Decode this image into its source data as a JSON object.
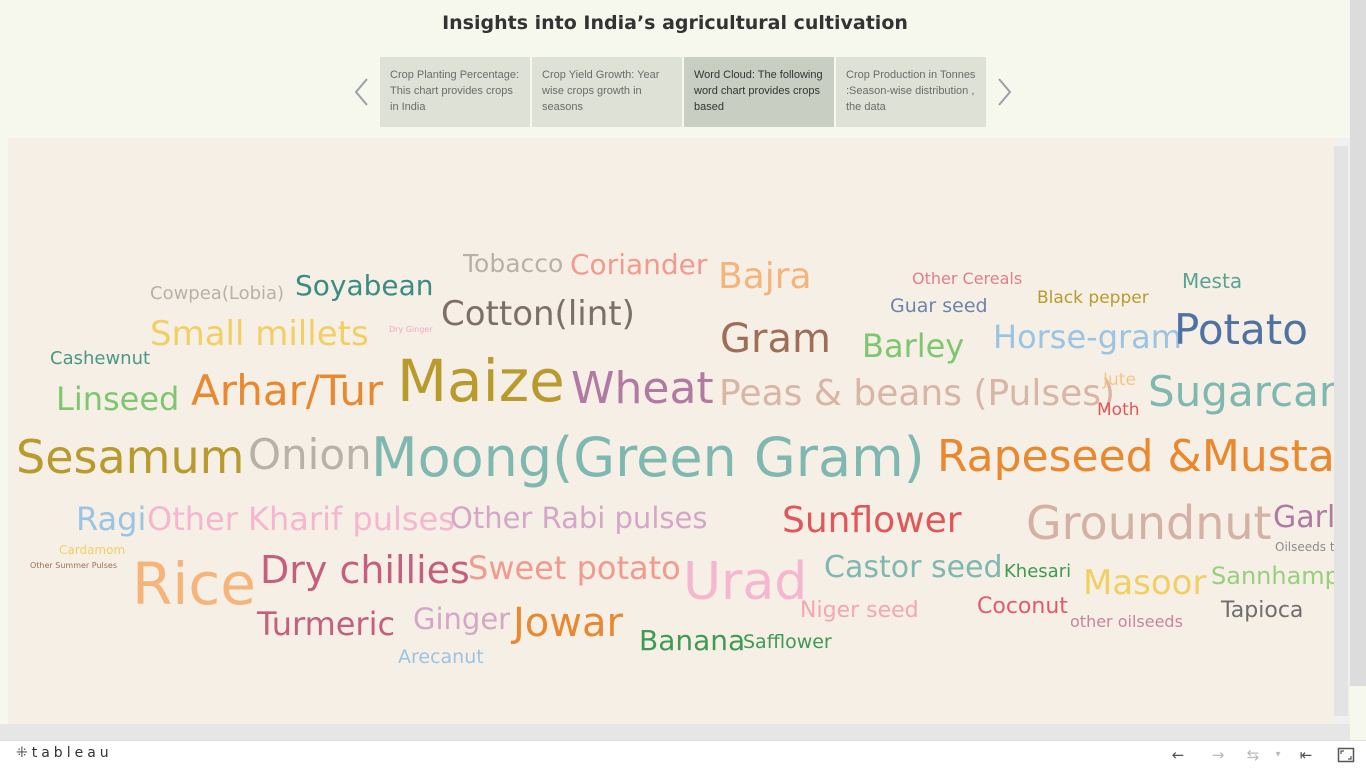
{
  "page": {
    "title": "Insights into India’s agricultural cultivation"
  },
  "story_points": [
    {
      "label": "Crop Planting Percentage: This chart provides crops in India",
      "active": false
    },
    {
      "label": "Crop Yield Growth: Year wise crops growth in seasons",
      "active": false
    },
    {
      "label": "Word Cloud: The following word chart provides crops based",
      "active": true
    },
    {
      "label": "Crop Production in Tonnes :Season-wise distribution , the data",
      "active": false
    }
  ],
  "nav": {
    "prev_icon": "chevron-left-icon",
    "next_icon": "chevron-right-icon"
  },
  "word_cloud": [
    {
      "text": "Tobacco",
      "color": "#b9b1a7"
    },
    {
      "text": "Coriander",
      "color": "#f19a8f"
    },
    {
      "text": "Bajra",
      "color": "#f5b57a"
    },
    {
      "text": "Other Cereals",
      "color": "#de7f8c"
    },
    {
      "text": "Mesta",
      "color": "#58a393"
    },
    {
      "text": "Cowpea(Lobia)",
      "color": "#b9b1a7"
    },
    {
      "text": "Soyabean",
      "color": "#3b8c82"
    },
    {
      "text": "Guar seed",
      "color": "#6b84a8"
    },
    {
      "text": "Black pepper",
      "color": "#b99a2d"
    },
    {
      "text": "Cotton(lint)",
      "color": "#7b6f66"
    },
    {
      "text": "Small millets",
      "color": "#f1cf63"
    },
    {
      "text": "Dry Ginger",
      "color": "#f3a6c3"
    },
    {
      "text": "Gram",
      "color": "#9e6e57"
    },
    {
      "text": "Barley",
      "color": "#7ec66f"
    },
    {
      "text": "Horse-gram",
      "color": "#9ac4e3"
    },
    {
      "text": "Potato",
      "color": "#4e72a2"
    },
    {
      "text": "Cashewnut",
      "color": "#4b9787"
    },
    {
      "text": "Linseed",
      "color": "#7ec66f"
    },
    {
      "text": "Arhar/Tur",
      "color": "#e9882e"
    },
    {
      "text": "Maize",
      "color": "#b99a2d"
    },
    {
      "text": "Wheat",
      "color": "#b07aa3"
    },
    {
      "text": "Peas & beans (Pulses)",
      "color": "#d8b5a5"
    },
    {
      "text": "Jute",
      "color": "#f5c582"
    },
    {
      "text": "Moth",
      "color": "#e15759"
    },
    {
      "text": "Sugarcane",
      "color": "#7fb8b0"
    },
    {
      "text": "Sesamum",
      "color": "#b99a2d"
    },
    {
      "text": "Onion",
      "color": "#b9b1a7"
    },
    {
      "text": "Moong(Green Gram)",
      "color": "#7fb8b0"
    },
    {
      "text": "Rapeseed &Mustard",
      "color": "#e9882e"
    },
    {
      "text": "Ragi",
      "color": "#9ac4e3"
    },
    {
      "text": "Other Kharif pulses",
      "color": "#f5b6cf"
    },
    {
      "text": "Other Rabi pulses",
      "color": "#d4a6c8"
    },
    {
      "text": "Sunflower",
      "color": "#e15759"
    },
    {
      "text": "Groundnut",
      "color": "#d4b0a5"
    },
    {
      "text": "Garlic",
      "color": "#b07aa3"
    },
    {
      "text": "Oilseeds total",
      "color": "#8c8c8c"
    },
    {
      "text": "Cardamom",
      "color": "#f1cf63"
    },
    {
      "text": "Other Summer Pulses",
      "color": "#9e6e57"
    },
    {
      "text": "Rice",
      "color": "#f5b57a"
    },
    {
      "text": "Dry chillies",
      "color": "#c4607e"
    },
    {
      "text": "Sweet potato",
      "color": "#f19a8f"
    },
    {
      "text": "Urad",
      "color": "#f5b6cf"
    },
    {
      "text": "Castor seed",
      "color": "#7fb8b0"
    },
    {
      "text": "Khesari",
      "color": "#3f9a53"
    },
    {
      "text": "Masoor",
      "color": "#f1cf63"
    },
    {
      "text": "Sannhamp",
      "color": "#96d07c"
    },
    {
      "text": "Turmeric",
      "color": "#c4607e"
    },
    {
      "text": "Ginger",
      "color": "#d4a6c8"
    },
    {
      "text": "Jowar",
      "color": "#e9882e"
    },
    {
      "text": "Niger seed",
      "color": "#f3a6b3"
    },
    {
      "text": "Coconut",
      "color": "#e05a6b"
    },
    {
      "text": "Tapioca",
      "color": "#6e6e6e"
    },
    {
      "text": "other oilseeds",
      "color": "#c9849f"
    },
    {
      "text": "Banana",
      "color": "#3f9a53"
    },
    {
      "text": "Safflower",
      "color": "#3f9a53"
    },
    {
      "text": "Arecanut",
      "color": "#9ac4e3"
    }
  ],
  "footer": {
    "logo": "tableau",
    "toolbar": [
      {
        "icon": "undo-icon",
        "enabled": true
      },
      {
        "icon": "redo-icon",
        "enabled": false
      },
      {
        "icon": "revert-icon",
        "enabled": false
      },
      {
        "icon": "revert-dropdown-icon",
        "enabled": false
      },
      {
        "icon": "revert-all-icon",
        "enabled": true
      },
      {
        "icon": "fullscreen-icon",
        "enabled": true
      }
    ]
  }
}
